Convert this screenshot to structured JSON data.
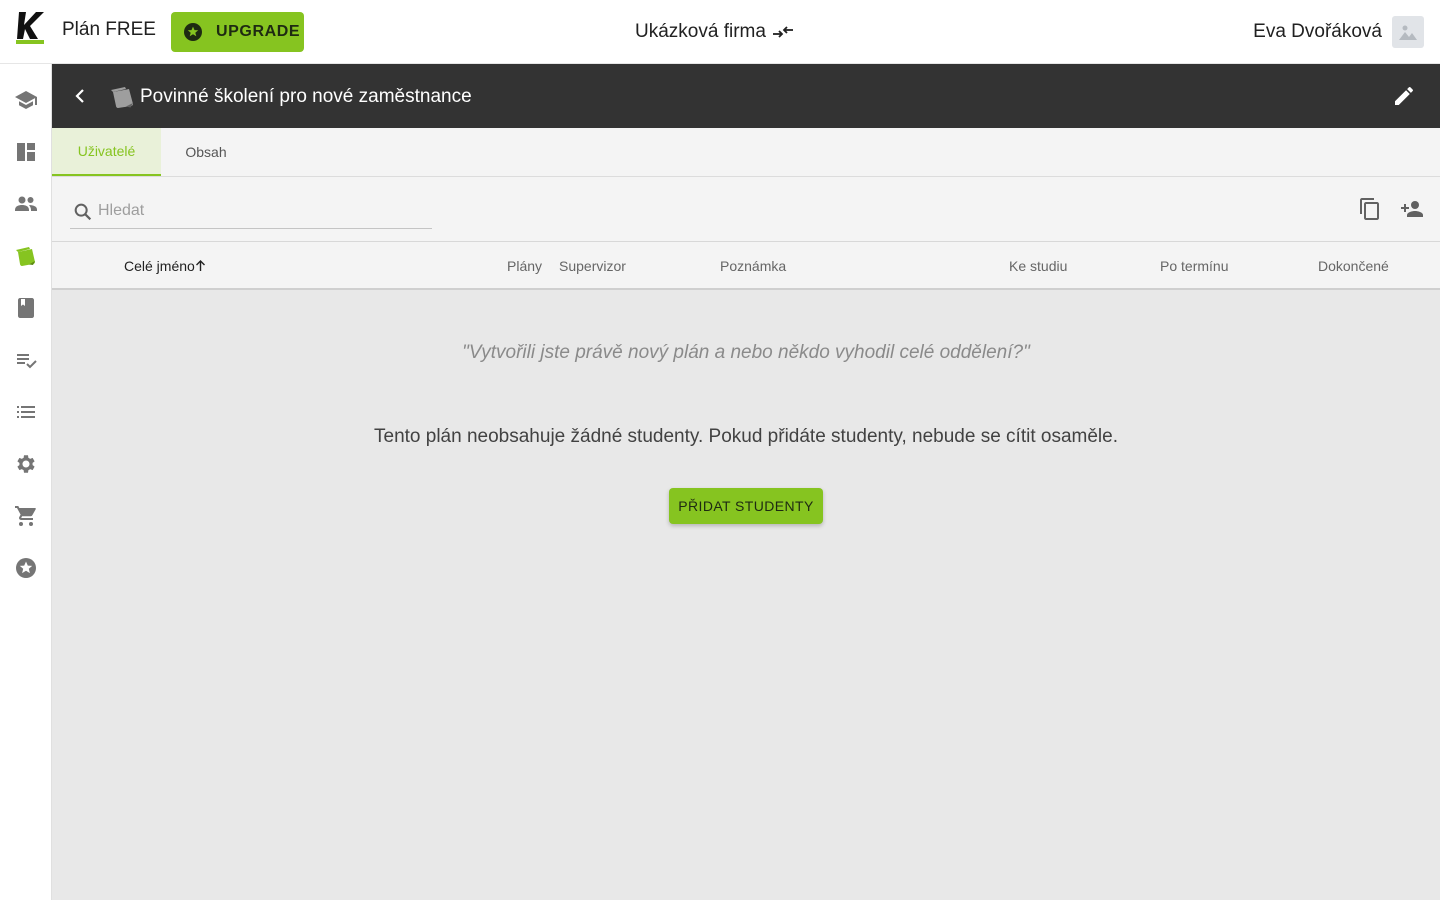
{
  "topbar": {
    "plan_label": "Plán FREE",
    "upgrade_label": "UPGRADE",
    "company_name": "Ukázková firma",
    "user_name": "Eva Dvořáková"
  },
  "header": {
    "title": "Povinné školení pro nové zaměstnance"
  },
  "tabs": [
    {
      "label": "Uživatelé",
      "active": true
    },
    {
      "label": "Obsah",
      "active": false
    }
  ],
  "search": {
    "placeholder": "Hledat",
    "value": ""
  },
  "table": {
    "columns": [
      "Celé jméno",
      "Plány",
      "Supervizor",
      "Poznámka",
      "Ke studiu",
      "Po termínu",
      "Dokončené"
    ],
    "sorted_column": "Celé jméno",
    "sort_direction": "ascending"
  },
  "empty_state": {
    "quote": "\"Vytvořili jste právě nový plán a nebo někdo vyhodil celé oddělení?\"",
    "message": "Tento plán neobsahuje žádné studenty. Pokud přidáte studenty, nebude se cítit osaměle.",
    "button_label": "PŘIDAT STUDENTY"
  },
  "sidebar": {
    "items": [
      "graduation-cap-icon",
      "dashboard-icon",
      "people-icon",
      "learning-plans-icon",
      "book-icon",
      "playlist-check-icon",
      "list-icon",
      "settings-icon",
      "cart-icon",
      "star-badge-icon"
    ],
    "active": "learning-plans-icon"
  },
  "colors": {
    "accent": "#86c420",
    "header_bg": "#333333",
    "content_bg": "#e8e8e8",
    "icon_gray": "#757575"
  }
}
